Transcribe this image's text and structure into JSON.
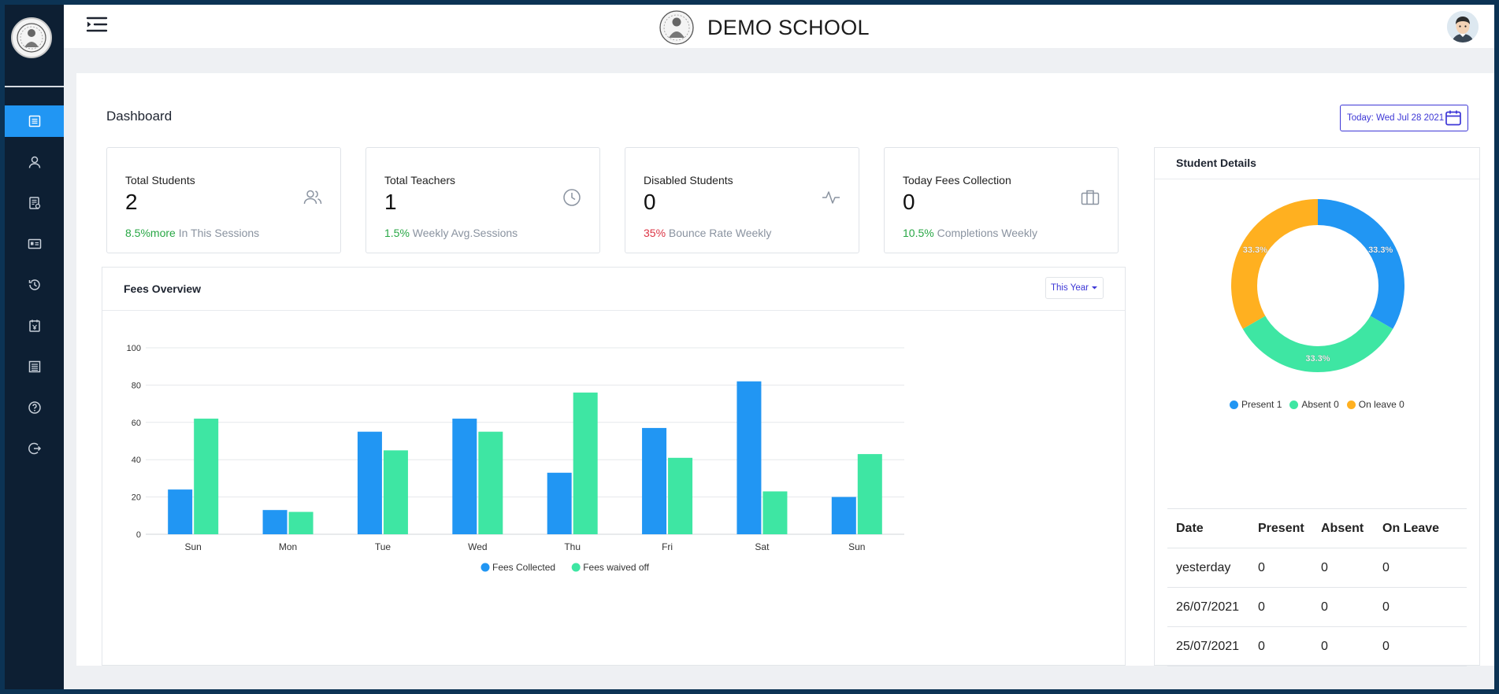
{
  "app": {
    "title": "DEMO SCHOOL"
  },
  "page": {
    "title": "Dashboard",
    "today_label": "Today: Wed Jul 28 2021"
  },
  "sidebar": {
    "items": [
      {
        "name": "dashboard",
        "icon": "document-list-icon",
        "active": true
      },
      {
        "name": "users",
        "icon": "user-icon",
        "active": false
      },
      {
        "name": "reports",
        "icon": "report-icon",
        "active": false
      },
      {
        "name": "id-cards",
        "icon": "id-card-icon",
        "active": false
      },
      {
        "name": "history",
        "icon": "history-icon",
        "active": false
      },
      {
        "name": "fees",
        "icon": "fee-calendar-icon",
        "active": false
      },
      {
        "name": "records",
        "icon": "records-icon",
        "active": false
      },
      {
        "name": "help",
        "icon": "help-icon",
        "active": false
      },
      {
        "name": "logout",
        "icon": "logout-icon",
        "active": false
      }
    ]
  },
  "stats": [
    {
      "label": "Total Students",
      "value": "2",
      "pct": "8.5%more",
      "pct_color": "green",
      "suffix": " In This Sessions",
      "icon": "users-icon"
    },
    {
      "label": "Total Teachers",
      "value": "1",
      "pct": "1.5%",
      "pct_color": "green",
      "suffix": " Weekly Avg.Sessions",
      "icon": "clock-icon"
    },
    {
      "label": "Disabled Students",
      "value": "0",
      "pct": "35%",
      "pct_color": "red",
      "suffix": " Bounce Rate Weekly",
      "icon": "activity-icon"
    },
    {
      "label": "Today Fees Collection",
      "value": "0",
      "pct": "10.5%",
      "pct_color": "green",
      "suffix": " Completions Weekly",
      "icon": "briefcase-icon"
    }
  ],
  "fees_overview": {
    "title": "Fees Overview",
    "period": "This Year"
  },
  "chart_data": [
    {
      "type": "bar",
      "categories": [
        "Sun",
        "Mon",
        "Tue",
        "Wed",
        "Thu",
        "Fri",
        "Sat",
        "Sun"
      ],
      "series": [
        {
          "name": "Fees Collected",
          "color": "#2196f3",
          "values": [
            24,
            13,
            55,
            62,
            33,
            57,
            82,
            20
          ]
        },
        {
          "name": "Fees waived off",
          "color": "#3ee6a3",
          "values": [
            62,
            12,
            45,
            55,
            76,
            41,
            23,
            43
          ]
        }
      ],
      "yticks": [
        0,
        20,
        40,
        60,
        80,
        100
      ],
      "ylim": [
        0,
        100
      ],
      "grid": true,
      "legend": "bottom"
    },
    {
      "type": "pie",
      "donut": true,
      "slices": [
        {
          "name": "Present",
          "count": "1",
          "color": "#2196f3",
          "percent": 33.3,
          "label": "33.3%"
        },
        {
          "name": "Absent",
          "count": "0",
          "color": "#3ee6a3",
          "percent": 33.3,
          "label": "33.3%"
        },
        {
          "name": "On leave",
          "count": "0",
          "color": "#ffb020",
          "percent": 33.3,
          "label": "33.3%"
        }
      ],
      "legend": "bottom"
    }
  ],
  "student_details": {
    "title": "Student Details",
    "legend": [
      {
        "label": "Present 1",
        "color": "#2196f3"
      },
      {
        "label": "Absent 0",
        "color": "#3ee6a3"
      },
      {
        "label": "On leave 0",
        "color": "#ffb020"
      }
    ],
    "table": {
      "headers": [
        "Date",
        "Present",
        "Absent",
        "On Leave"
      ],
      "rows": [
        [
          "yesterday",
          "0",
          "0",
          "0"
        ],
        [
          "26/07/2021",
          "0",
          "0",
          "0"
        ],
        [
          "25/07/2021",
          "0",
          "0",
          "0"
        ]
      ]
    }
  }
}
